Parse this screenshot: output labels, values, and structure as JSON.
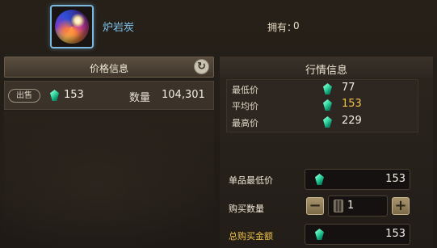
{
  "item": {
    "name": "炉岩炭",
    "icon": "lava-orb-icon"
  },
  "ownership": {
    "label": "拥有：",
    "count": "0"
  },
  "price_panel": {
    "title": "价格信息",
    "refresh_icon": "refresh-icon",
    "listings": [
      {
        "badge": "出售",
        "price": "153",
        "qty_label": "数量",
        "qty": "104,301"
      }
    ]
  },
  "market_panel": {
    "title": "行情信息",
    "rows": [
      {
        "label": "最低价",
        "value": "77"
      },
      {
        "label": "平均价",
        "value": "153"
      },
      {
        "label": "最高价",
        "value": "229"
      }
    ]
  },
  "purchase": {
    "unit_min_label": "单品最低价",
    "unit_min_value": "153",
    "qty_label": "购买数量",
    "qty_value": "1",
    "minus": "−",
    "plus": "+",
    "total_label": "总购买金额",
    "total_value": "153"
  },
  "colors": {
    "accent_gold": "#f0c24a",
    "item_name_blue": "#7ec4ee",
    "currency_gem": "#3ee0a8"
  },
  "currency_icon": "green-gem-icon"
}
